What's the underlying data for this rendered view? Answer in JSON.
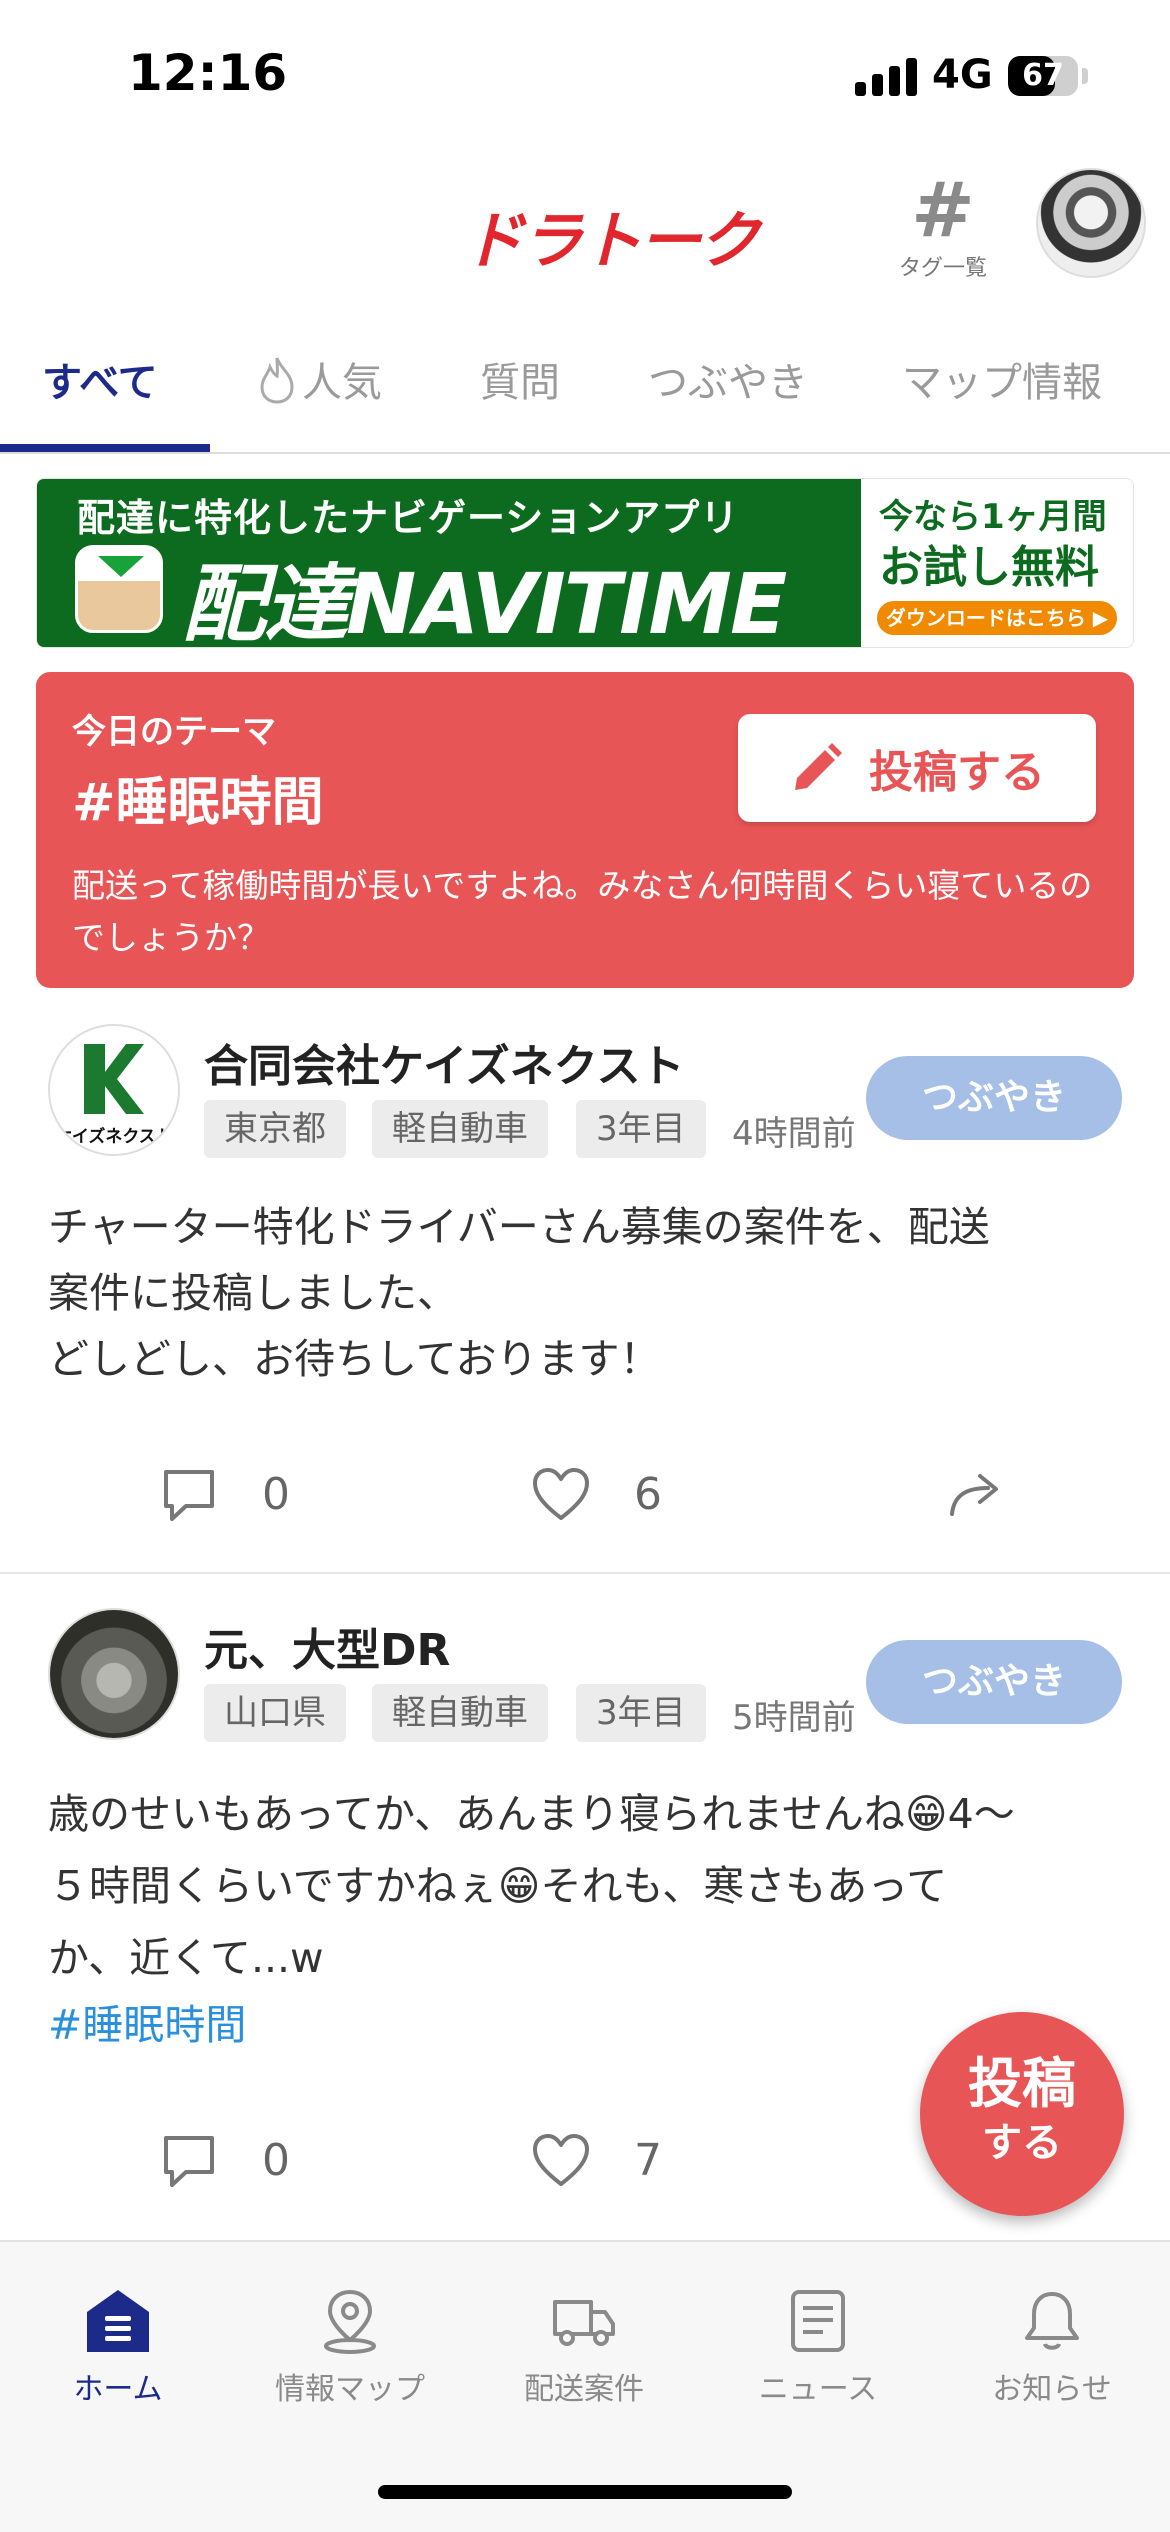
{
  "status_bar": {
    "time": "12:16",
    "network": "4G",
    "battery": "67",
    "battery_level_percent": 67
  },
  "header": {
    "logo": "ドラトーク",
    "tag_list_label": "タグ一覧"
  },
  "tabs": [
    {
      "label": "すべて",
      "active": true
    },
    {
      "label": "人気",
      "icon": "fire-icon"
    },
    {
      "label": "質問"
    },
    {
      "label": "つぶやき"
    },
    {
      "label": "マップ情報"
    }
  ],
  "banner": {
    "tagline": "配達に特化したナビゲーションアプリ",
    "title": "配達NAVITIME",
    "offer_line1": "今なら1ヶ月間",
    "offer_line2": "お試し無料",
    "download": "ダウンロードはこちら ▶",
    "colors": {
      "bg": "#0d6b1f",
      "accent": "#f08a00"
    }
  },
  "theme": {
    "label": "今日のテーマ",
    "tag": "#睡眠時間",
    "post_button": "投稿する",
    "description": "配送って稼働時間が長いですよね。みなさん何時間くらい寝ているのでしょうか？",
    "color": "#e85556"
  },
  "posts": [
    {
      "author": "合同会社ケイズネクスト",
      "avatar_text": "ケイズネクスト",
      "chips": [
        "東京都",
        "軽自動車",
        "3年目"
      ],
      "time": "4時間前",
      "type": "つぶやき",
      "body_lines": [
        "チャーター特化ドライバーさん募集の案件を、配送",
        "案件に投稿しました、",
        "どしどし、お待ちしております！"
      ],
      "comments": "0",
      "likes": "6"
    },
    {
      "author": "元、大型DR",
      "chips": [
        "山口県",
        "軽自動車",
        "3年目"
      ],
      "time": "5時間前",
      "type": "つぶやき",
      "body_lines": [
        "歳のせいもあってか、あんまり寝られませんね😁4〜",
        "５時間くらいですかねぇ😁それも、寒さもあって",
        "か、近くて...w"
      ],
      "hashtag": "#睡眠時間",
      "comments": "0",
      "likes": "7"
    }
  ],
  "fab": {
    "line1": "投稿",
    "line2": "する"
  },
  "bottom_nav": [
    {
      "label": "ホーム",
      "icon": "home-icon",
      "active": true
    },
    {
      "label": "情報マップ",
      "icon": "map-pin-icon"
    },
    {
      "label": "配送案件",
      "icon": "truck-icon"
    },
    {
      "label": "ニュース",
      "icon": "news-icon"
    },
    {
      "label": "お知らせ",
      "icon": "bell-icon"
    }
  ]
}
